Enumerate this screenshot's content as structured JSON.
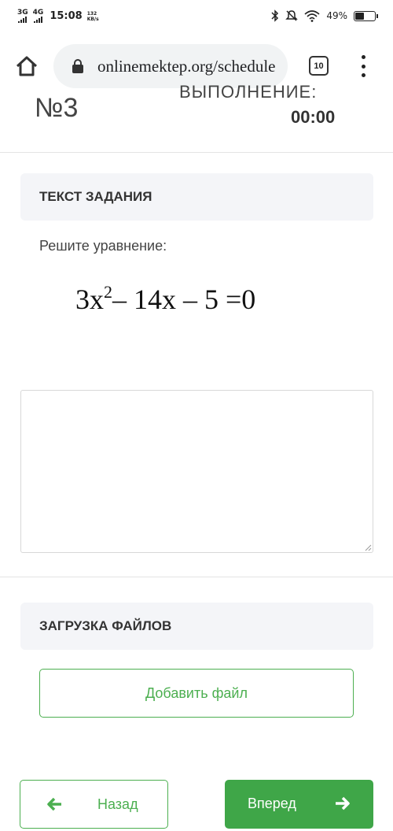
{
  "status_bar": {
    "network_1": "3G",
    "network_2": "4G",
    "time": "15:08",
    "speed_value": "132",
    "speed_unit": "KB/s",
    "battery_percent": "49%",
    "battery_level": 0.49,
    "icons": [
      "bluetooth-icon",
      "mute-icon",
      "wifi-icon",
      "battery-icon"
    ]
  },
  "browser": {
    "url": "onlinemektep.org/schedule",
    "tab_count": "10",
    "icons": [
      "home-icon",
      "lock-icon",
      "tabs-icon",
      "more-menu-icon"
    ]
  },
  "header": {
    "task_number": "№3",
    "timer_label": "ВЫПОЛНЕНИЕ:",
    "timer_value": "00:00"
  },
  "task": {
    "section_title": "ТЕКСТ ЗАДАНИЯ",
    "prompt": "Решите уравнение:",
    "equation": {
      "coef": "3x",
      "power": "2",
      "rest": "– 14x – 5 =0"
    }
  },
  "answer": {
    "value": ""
  },
  "files": {
    "section_title": "ЗАГРУЗКА ФАЙЛОВ",
    "add_button": "Добавить файл"
  },
  "navigation": {
    "back_label": "Назад",
    "next_label": "Вперед"
  },
  "colors": {
    "accent": "#3fa648",
    "section_bg": "#f4f5f8"
  }
}
